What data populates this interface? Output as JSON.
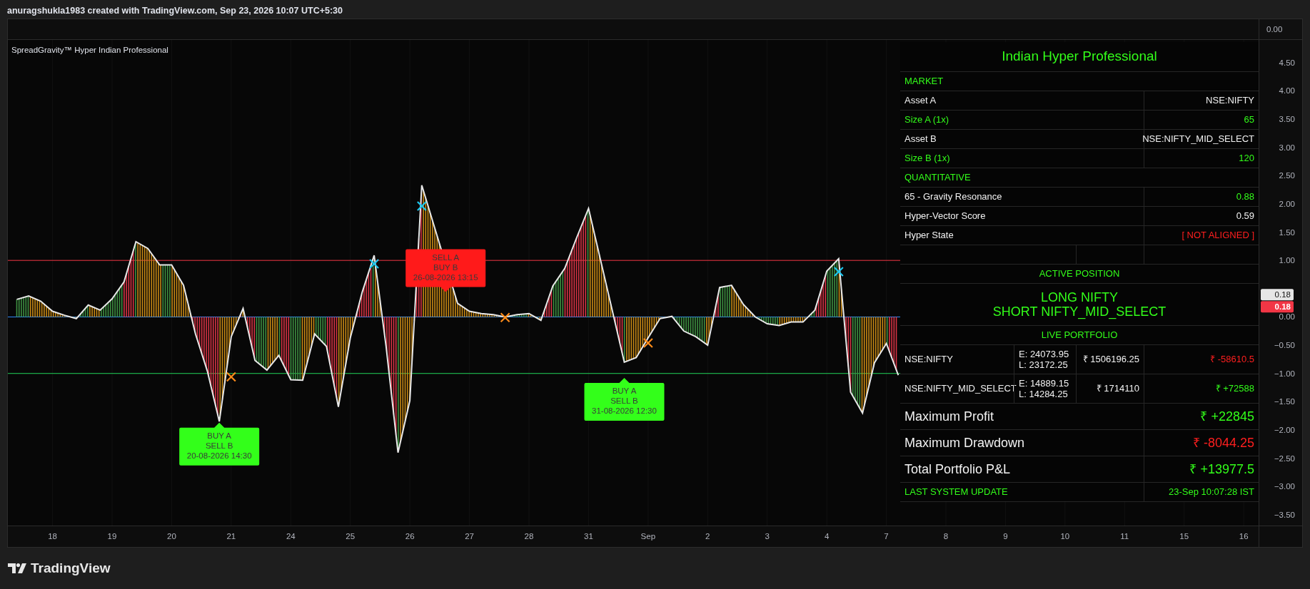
{
  "header": {
    "attribution": "anuragshukla1983 created with TradingView.com, Sep 23, 2026 10:07 UTC+5:30"
  },
  "main_pane": {
    "axis_label": "0.00"
  },
  "indicator_pane": {
    "title": "SpreadGravity™ Hyper Indian Professional",
    "chart_data": {
      "type": "line",
      "grid": true,
      "categories": [
        null,
        null,
        null,
        null,
        "18",
        null,
        null,
        null,
        null,
        "19",
        null,
        null,
        null,
        null,
        "20",
        null,
        null,
        null,
        null,
        "21",
        null,
        null,
        null,
        null,
        "24",
        null,
        null,
        null,
        null,
        "25",
        null,
        null,
        null,
        null,
        "26",
        null,
        null,
        null,
        null,
        "27",
        null,
        null,
        null,
        null,
        "28",
        null,
        null,
        null,
        null,
        "31",
        null,
        null,
        null,
        null,
        "Sep",
        null,
        null,
        null,
        null,
        "2",
        null,
        null,
        null,
        null,
        "3",
        null,
        null,
        null,
        null,
        "4",
        null,
        null,
        null,
        null,
        "7",
        null,
        null,
        null,
        null,
        "8",
        null,
        null,
        null,
        null,
        "9",
        null,
        null,
        null,
        null,
        "10",
        null,
        null,
        null,
        null,
        "11",
        null,
        null,
        null,
        null,
        "15",
        null,
        null,
        null,
        null,
        "16",
        null
      ],
      "series": [
        {
          "color": "#e8e8e8",
          "values": [
            null,
            0.31,
            0.37,
            0.28,
            0.1,
            0.03,
            -0.03,
            0.21,
            0.12,
            0.32,
            0.62,
            1.33,
            1.21,
            0.92,
            0.92,
            0.56,
            -0.3,
            -0.96,
            -1.85,
            -0.35,
            0.15,
            -0.77,
            -0.94,
            -0.68,
            -1.11,
            -1.12,
            -0.3,
            -0.52,
            -1.59,
            -0.37,
            0.44,
            1.09,
            -0.52,
            -2.4,
            -1.48,
            2.33,
            null,
            null,
            0.24,
            0.1,
            0.06,
            0.04,
            0.0,
            0.04,
            0.06,
            -0.06,
            0.55,
            0.86,
            1.4,
            1.92,
            null,
            null,
            -0.8,
            -0.72,
            -0.37,
            -0.03,
            0.01,
            -0.25,
            -0.35,
            -0.5,
            0.52,
            0.56,
            0.22,
            0.0,
            -0.12,
            -0.15,
            -0.09,
            -0.09,
            0.12,
            0.81,
            1.03,
            -1.33,
            -1.7,
            -0.81,
            -0.47,
            -1.03,
            null,
            null,
            null,
            null,
            null,
            null,
            null,
            null,
            null,
            null,
            null,
            null,
            null,
            null,
            null,
            null,
            null,
            null,
            null,
            null,
            null,
            null,
            null,
            null,
            null,
            null,
            null,
            null,
            null,
            null
          ]
        },
        {
          "color": "#ff8c1a",
          "marker": "x",
          "values": [
            null,
            null,
            null,
            null,
            null,
            null,
            null,
            null,
            null,
            null,
            null,
            null,
            null,
            null,
            null,
            null,
            null,
            null,
            null,
            -1.06,
            null,
            null,
            null,
            null,
            null,
            null,
            null,
            null,
            null,
            null,
            null,
            null,
            null,
            null,
            null,
            null,
            null,
            null,
            null,
            null,
            null,
            null,
            -0.01,
            null,
            null,
            null,
            null,
            null,
            null,
            null,
            null,
            null,
            null,
            null,
            -0.46,
            null,
            null,
            null,
            null,
            null,
            null,
            null,
            null,
            null,
            null,
            null,
            null,
            null,
            null,
            null,
            null,
            null,
            null,
            null,
            null,
            null,
            null,
            null,
            null,
            null,
            null,
            null,
            null,
            null,
            null,
            null,
            null,
            null,
            null,
            null,
            null,
            null,
            null,
            null,
            null,
            null,
            null,
            null,
            null,
            null,
            null,
            null,
            null,
            null,
            null,
            null
          ]
        },
        {
          "color": "#1ec8f0",
          "marker": "x",
          "values": [
            null,
            null,
            null,
            null,
            null,
            null,
            null,
            null,
            null,
            null,
            null,
            null,
            null,
            null,
            null,
            null,
            null,
            null,
            null,
            null,
            null,
            null,
            null,
            null,
            null,
            null,
            null,
            null,
            null,
            null,
            null,
            0.94,
            null,
            null,
            null,
            1.96,
            null,
            null,
            null,
            null,
            null,
            null,
            null,
            null,
            null,
            null,
            null,
            null,
            null,
            null,
            null,
            null,
            null,
            null,
            null,
            null,
            null,
            null,
            null,
            null,
            null,
            null,
            null,
            null,
            null,
            null,
            null,
            null,
            null,
            null,
            0.8,
            null,
            null,
            null,
            null,
            null,
            null,
            null,
            null,
            null,
            null,
            null,
            null,
            null,
            null,
            null,
            null,
            null,
            null,
            null,
            null,
            null,
            null,
            null,
            null,
            null,
            null,
            null,
            null,
            null,
            null,
            null,
            null,
            null,
            null,
            null
          ]
        }
      ],
      "ylim": [
        -3.69,
        4.9
      ],
      "yticks": [
        {
          "value": 4.5,
          "label": "4.50"
        },
        {
          "value": 4,
          "label": "4.00"
        },
        {
          "value": 3.5,
          "label": "3.50"
        },
        {
          "value": 3,
          "label": "3.00"
        },
        {
          "value": 2.5,
          "label": "2.50"
        },
        {
          "value": 2,
          "label": "2.00"
        },
        {
          "value": 1.5,
          "label": "1.50"
        },
        {
          "value": 1,
          "label": "1.00"
        },
        {
          "value": 0,
          "label": "0.00"
        },
        {
          "value": -0.5,
          "label": "−0.50"
        },
        {
          "value": -1,
          "label": "−1.00"
        },
        {
          "value": -1.5,
          "label": "−1.50"
        },
        {
          "value": -2,
          "label": "−2.00"
        },
        {
          "value": -2.5,
          "label": "−2.50"
        },
        {
          "value": -3,
          "label": "−3.00"
        },
        {
          "value": -3.5,
          "label": "−3.50"
        }
      ],
      "ref_lines": [
        {
          "axis": "y",
          "value": 1,
          "color": "#f23645"
        },
        {
          "axis": "y",
          "value": 0,
          "color": "#2f8cff"
        },
        {
          "axis": "y",
          "value": -1,
          "color": "#22d65a"
        }
      ],
      "annotations": [
        "BUY A\nSELL B\n20-08-2026 14:30",
        "SELL A\nBUY B\n26-08-2026 13:15",
        "BUY A\nSELL B\n31-08-2026 12:30"
      ]
    },
    "price_labels": [
      {
        "color": "#e6e6e6",
        "text": "0.18"
      },
      {
        "color": "#f23645",
        "text": "0.18"
      }
    ]
  },
  "table": {
    "rows": [
      {
        "kind": "title",
        "text": "Indian Hyper Professional"
      },
      {
        "kind": "section",
        "text": "MARKET"
      },
      {
        "kind": "pair",
        "label": {
          "text": "Asset A",
          "color": "#f2f2f2"
        },
        "value": {
          "text": "NSE:NIFTY",
          "color": "#f2f2f2"
        }
      },
      {
        "kind": "pair",
        "label": {
          "text": "Size A (1x)",
          "color": "#33ff1a"
        },
        "value": {
          "text": "65",
          "color": "#33ff1a"
        }
      },
      {
        "kind": "pair",
        "label": {
          "text": "Asset B",
          "color": "#f2f2f2"
        },
        "value": {
          "text": "NSE:NIFTY_MID_SELECT",
          "color": "#f2f2f2"
        }
      },
      {
        "kind": "pair",
        "label": {
          "text": "Size B (1x)",
          "color": "#33ff1a"
        },
        "value": {
          "text": "120",
          "color": "#33ff1a"
        }
      },
      {
        "kind": "section",
        "text": "QUANTITATIVE"
      },
      {
        "kind": "pair",
        "label": {
          "text": "65 - Gravity Resonance",
          "color": "#f2f2f2"
        },
        "value": {
          "text": "0.88",
          "color": "#33ff1a"
        }
      },
      {
        "kind": "pair",
        "label": {
          "text": "Hyper-Vector Score",
          "color": "#f2f2f2"
        },
        "value": {
          "text": "0.59",
          "color": "#f2f2f2"
        }
      },
      {
        "kind": "pair",
        "label": {
          "text": "Hyper State",
          "color": "#f2f2f2"
        },
        "value": {
          "text": "[ NOT ALIGNED ]",
          "color": "#ff1f1f"
        }
      },
      {
        "kind": "spacer"
      },
      {
        "kind": "heading",
        "text": "ACTIVE POSITION"
      },
      {
        "kind": "position",
        "lines": [
          "LONG NIFTY",
          "SHORT NIFTY_MID_SELECT"
        ]
      },
      {
        "kind": "heading",
        "text": "LIVE PORTFOLIO"
      },
      {
        "kind": "portfolio",
        "asset": "NSE:NIFTY",
        "entry": "E: 24073.95",
        "last": "L: 23172.25",
        "value": "₹ 1506196.25",
        "pnl": {
          "text": "₹ -58610.5",
          "color": "#ff1f1f"
        }
      },
      {
        "kind": "portfolio",
        "asset": "NSE:NIFTY_MID_SELECT",
        "entry": "E: 14889.15",
        "last": "L: 14284.25",
        "value": "₹ 1714110",
        "pnl": {
          "text": "₹ +72588",
          "color": "#33ff1a"
        }
      },
      {
        "kind": "metric",
        "label": "Maximum Profit",
        "value": {
          "text": "₹ +22845",
          "color": "#33ff1a"
        }
      },
      {
        "kind": "metric",
        "label": "Maximum Drawdown",
        "value": {
          "text": "₹ -8044.25",
          "color": "#ff1f1f"
        }
      },
      {
        "kind": "metric",
        "label": "Total Portfolio P&L",
        "value": {
          "text": "₹ +13977.5",
          "color": "#33ff1a"
        }
      },
      {
        "kind": "footer",
        "label": "LAST SYSTEM UPDATE",
        "value": "23-Sep 10:07:28 IST"
      }
    ]
  },
  "footer": {
    "brand": "TradingView"
  }
}
